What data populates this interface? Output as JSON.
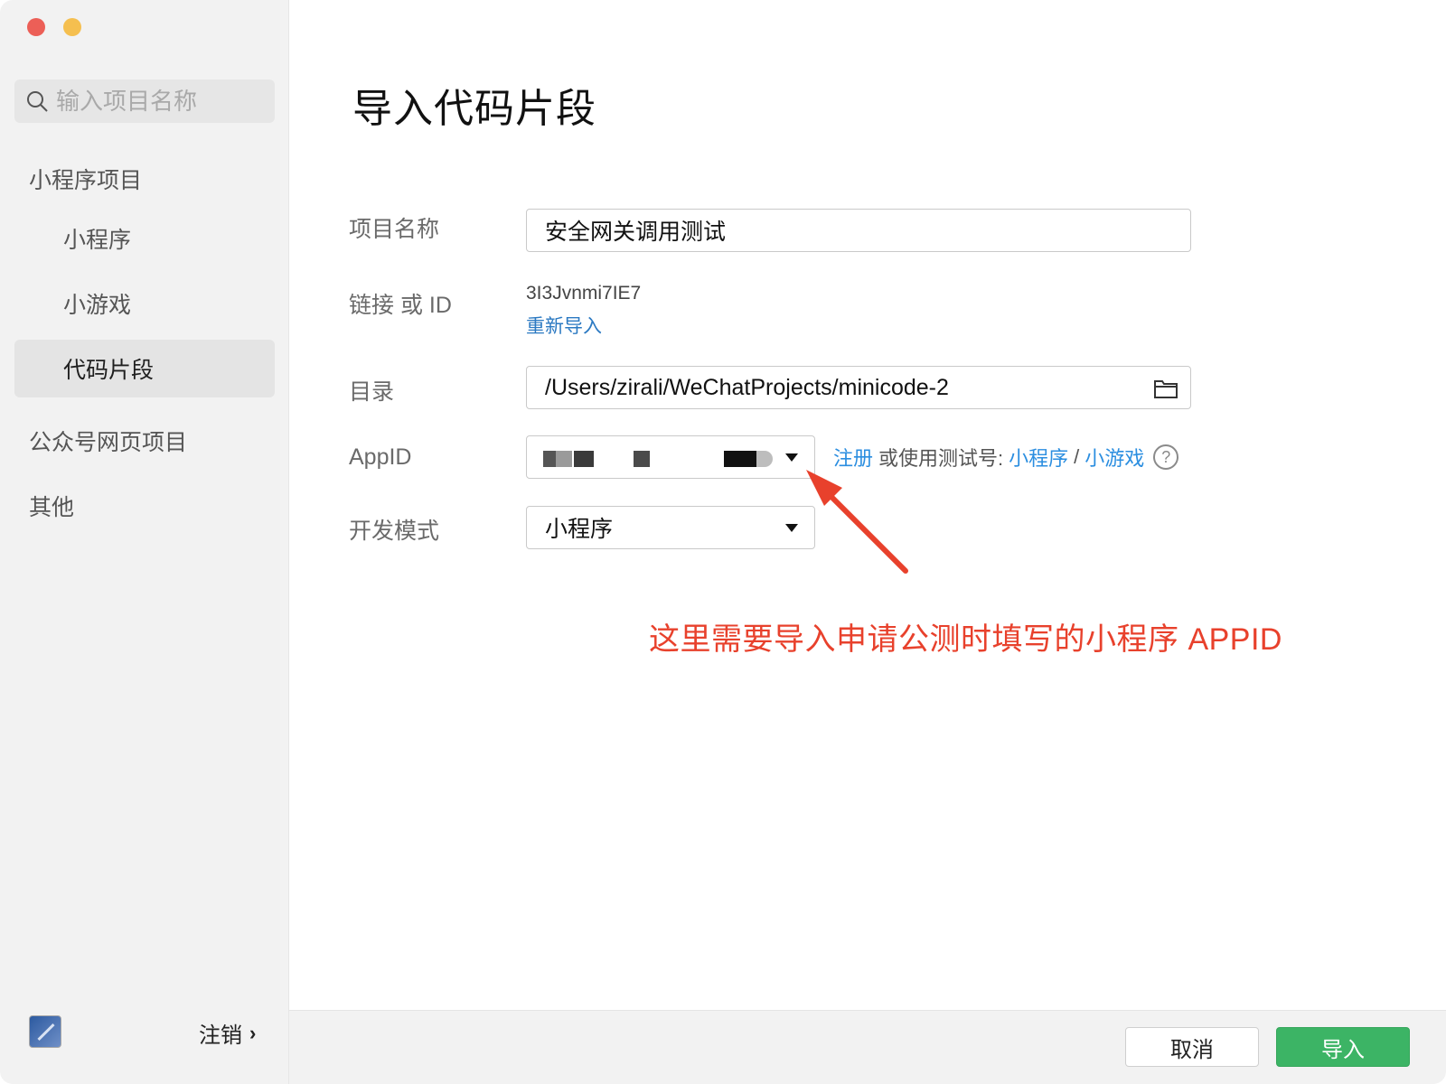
{
  "sidebar": {
    "search_placeholder": "输入项目名称",
    "groups": [
      {
        "label": "小程序项目"
      },
      {
        "label": "公众号网页项目"
      },
      {
        "label": "其他"
      }
    ],
    "items": [
      {
        "label": "小程序"
      },
      {
        "label": "小游戏"
      },
      {
        "label": "代码片段",
        "active": true
      }
    ],
    "logout_label": "注销"
  },
  "main": {
    "title": "导入代码片段",
    "form": {
      "project_name_label": "项目名称",
      "project_name_value": "安全网关调用测试",
      "link_id_label": "链接 或 ID",
      "link_id_value": "3I3Jvnmi7IE7",
      "reimport_label": "重新导入",
      "directory_label": "目录",
      "directory_value": "/Users/zirali/WeChatProjects/minicode-2",
      "appid_label": "AppID",
      "register_link": "注册",
      "test_account_text": "或使用测试号:",
      "test_miniprogram_link": "小程序",
      "slash": "/",
      "test_minigame_link": "小游戏",
      "help": "?",
      "dev_mode_label": "开发模式",
      "dev_mode_value": "小程序"
    },
    "annotation": "这里需要导入申请公测时填写的小程序 APPID"
  },
  "footer": {
    "cancel_label": "取消",
    "import_label": "导入"
  },
  "colors": {
    "accent_green": "#3cb465",
    "link_blue": "#2b8ee0",
    "annotation_red": "#e8412c"
  }
}
